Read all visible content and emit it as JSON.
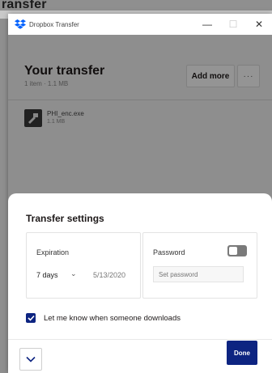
{
  "background": {
    "title_fragment": "ransfer"
  },
  "window": {
    "title": "Dropbox Transfer",
    "controls": {
      "minimize": "—",
      "maximize": "☐",
      "close": "✕"
    }
  },
  "transfer": {
    "title": "Your transfer",
    "subtitle": "1 item · 1.1 MB",
    "add_more_label": "Add more",
    "more_label": "···",
    "file": {
      "name": "PHI_enc.exe",
      "size": "1.1 MB"
    }
  },
  "settings": {
    "title": "Transfer settings",
    "expiration": {
      "label": "Expiration",
      "value": "7 days",
      "chevron": "⌄",
      "date": "5/13/2020"
    },
    "password": {
      "label": "Password",
      "toggle_on": false,
      "placeholder": "Set password",
      "value": ""
    },
    "notify": {
      "label": "Let me know when someone downloads",
      "checked": true
    },
    "done_label": "Done"
  },
  "colors": {
    "accent": "#0d2481",
    "dropbox_blue": "#0061fe",
    "toggle_off": "#7a7a7a"
  },
  "icons": [
    "dropbox-logo-icon",
    "minimize-icon",
    "maximize-icon",
    "close-icon",
    "exe-file-icon",
    "chevron-down-icon",
    "checkmark-icon"
  ]
}
